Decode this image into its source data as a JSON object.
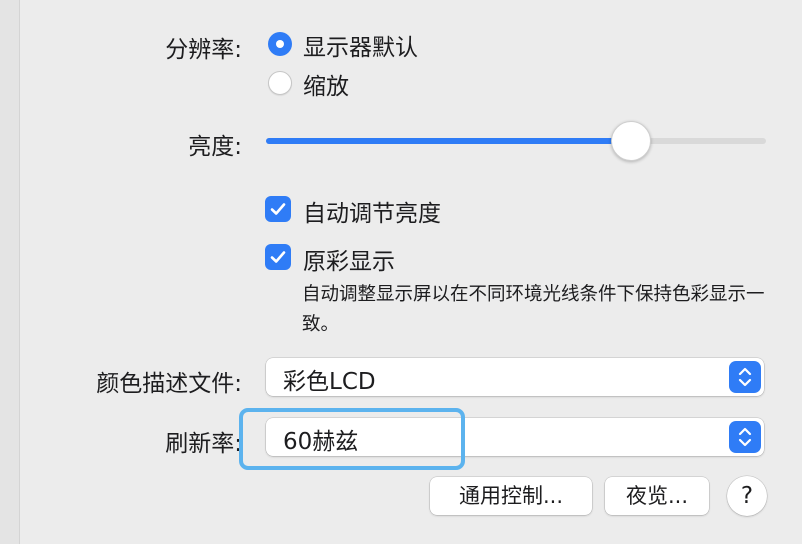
{
  "resolution": {
    "label": "分辨率:",
    "options": [
      {
        "label": "显示器默认",
        "selected": true
      },
      {
        "label": "缩放",
        "selected": false
      }
    ]
  },
  "brightness": {
    "label": "亮度:",
    "level_percent": 73
  },
  "auto_brightness": {
    "label": "自动调节亮度",
    "checked": true
  },
  "true_tone": {
    "label": "原彩显示",
    "checked": true,
    "description": "自动调整显示屏以在不同环境光线条件下保持色彩显示一致。"
  },
  "color_profile": {
    "label": "颜色描述文件:",
    "value": "彩色LCD"
  },
  "refresh_rate": {
    "label": "刷新率:",
    "value": "60赫兹"
  },
  "buttons": {
    "universal_control": "通用控制...",
    "night_shift": "夜览...",
    "help": "?"
  },
  "colors": {
    "accent": "#2f7cf6",
    "highlight_outline": "#5cb3ee",
    "background": "#ececec"
  }
}
